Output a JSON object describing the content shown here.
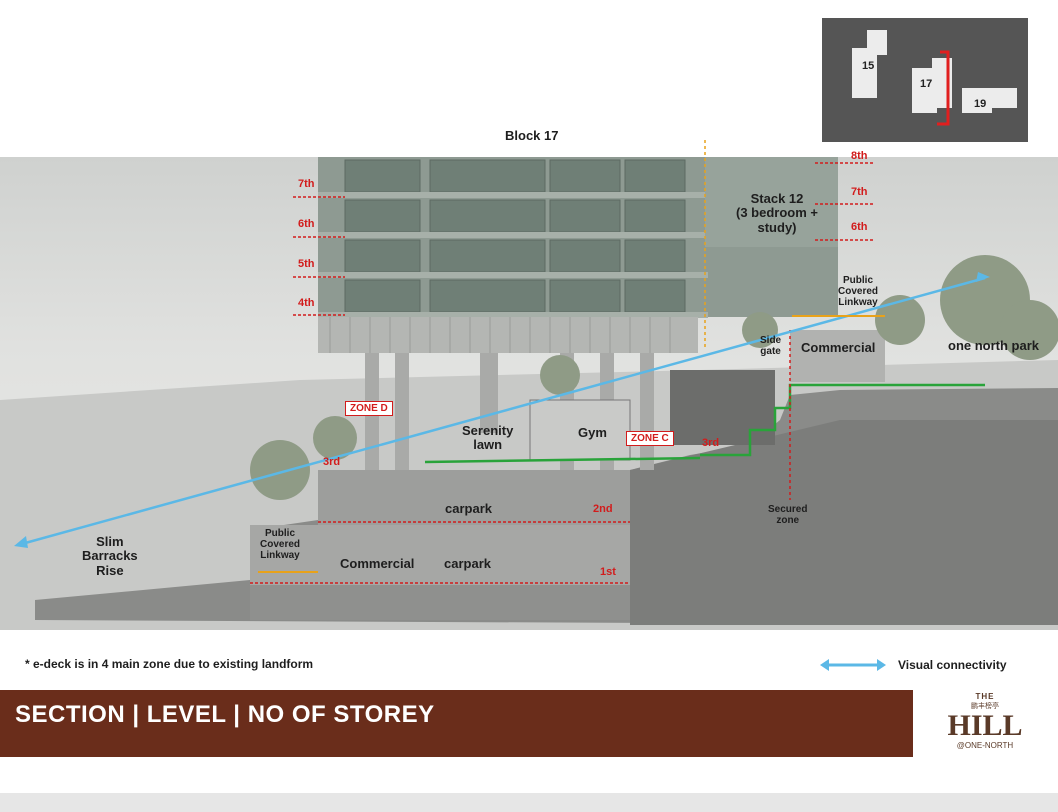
{
  "minimap": {
    "block_15": "15",
    "block_17": "17",
    "block_19": "19"
  },
  "diagram": {
    "block_title": "Block 17",
    "stack_label": "Stack 12",
    "stack_sub": "(3 bedroom +",
    "stack_sub2": "study)",
    "floors_left": [
      "7th",
      "6th",
      "5th",
      "4th"
    ],
    "floors_right": [
      "8th",
      "7th",
      "6th"
    ],
    "floor_3_left": "3rd",
    "floor_3_right": "3rd",
    "floor_2": "2nd",
    "floor_1": "1st",
    "zone_d": "ZONE D",
    "zone_c": "ZONE C",
    "serenity_lawn": [
      "Serenity",
      "lawn"
    ],
    "gym": "Gym",
    "carpark_upper": "carpark",
    "carpark_lower": "carpark",
    "commercial_lower": "Commercial",
    "commercial_upper": "Commercial",
    "public_linkway_left": [
      "Public",
      "Covered",
      "Linkway"
    ],
    "public_linkway_right": [
      "Public",
      "Covered",
      "Linkway"
    ],
    "side_gate": [
      "Side",
      "gate"
    ],
    "secured_zone": [
      "Secured",
      "zone"
    ],
    "one_north_park": "one north park",
    "slim_barracks": [
      "Slim",
      "Barracks",
      "Rise"
    ]
  },
  "footer": {
    "note": "* e-deck is in 4 main zone due to existing landform",
    "legend_label": "Visual connectivity",
    "title": "SECTION | LEVEL | NO OF STOREY",
    "logo_top": "THE",
    "logo_chinese": "鹏丰榜亭",
    "logo_main": "HILL",
    "logo_sub": "@ONE-NORTH"
  },
  "colors": {
    "brand": "#6a2d1b",
    "marker": "#d21c1c",
    "visual_line": "#5bb8e6",
    "green_path": "#29a33a",
    "linkway": "#e8a21a"
  }
}
